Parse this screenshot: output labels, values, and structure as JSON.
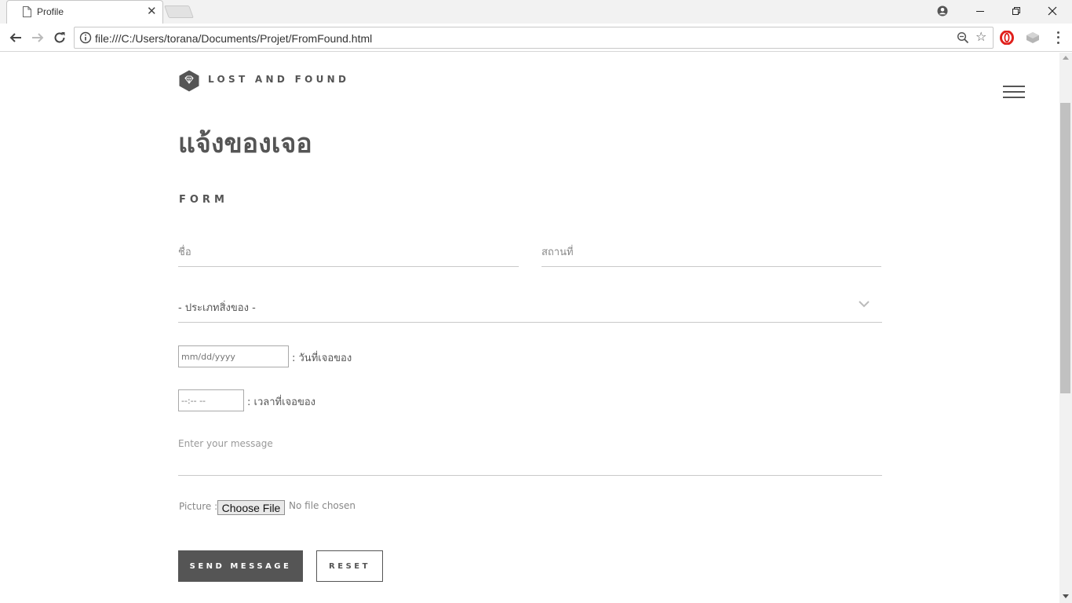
{
  "browser": {
    "tab_title": "Profile",
    "tab_close": "✕",
    "url": "file:///C:/Users/torana/Documents/Projet/FromFound.html",
    "star": "☆"
  },
  "page": {
    "brand": "LOST AND FOUND",
    "title": "แจ้งของเจอ",
    "section_label": "FORM",
    "name_placeholder": "ชื่อ",
    "place_placeholder": "สถานที่",
    "category_selected": "- ประเภทสิ่งของ -",
    "date_placeholder": "mm/dd/yyyy",
    "date_label": ": วันที่เจอของ",
    "time_placeholder": "--:-- --",
    "time_label": ": เวลาที่เจอของ",
    "message_placeholder": "Enter your message",
    "picture_label": "Picture :",
    "file_button": "Choose File",
    "file_status": "No file chosen",
    "send_button": "SEND MESSAGE",
    "reset_button": "RESET"
  },
  "colors": {
    "accent": "#555555",
    "border": "#c9c9c9"
  },
  "icons": {
    "logo": "diamond-hexagon-icon",
    "menu": "hamburger-icon",
    "select": "chevron-down-icon"
  }
}
